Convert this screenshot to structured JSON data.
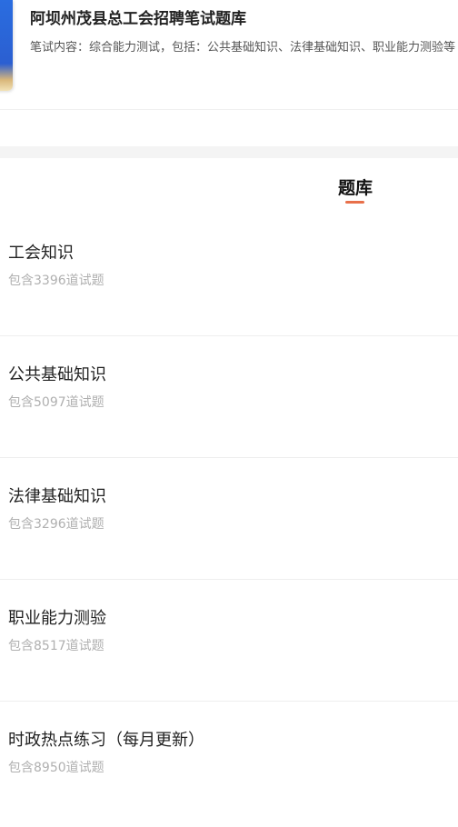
{
  "header": {
    "title": "阿坝州茂县总工会招聘笔试题库",
    "description": "笔试内容：综合能力测试，包括：公共基础知识、法律基础知识、职业能力测验等"
  },
  "tabs": [
    {
      "label": "题库",
      "active": true
    }
  ],
  "accent_color": "#e8704a",
  "question_banks": [
    {
      "title": "工会知识",
      "subtitle": "包含3396道试题"
    },
    {
      "title": "公共基础知识",
      "subtitle": "包含5097道试题"
    },
    {
      "title": "法律基础知识",
      "subtitle": "包含3296道试题"
    },
    {
      "title": "职业能力测验",
      "subtitle": "包含8517道试题"
    },
    {
      "title": "时政热点练习（每月更新）",
      "subtitle": "包含8950道试题"
    }
  ]
}
